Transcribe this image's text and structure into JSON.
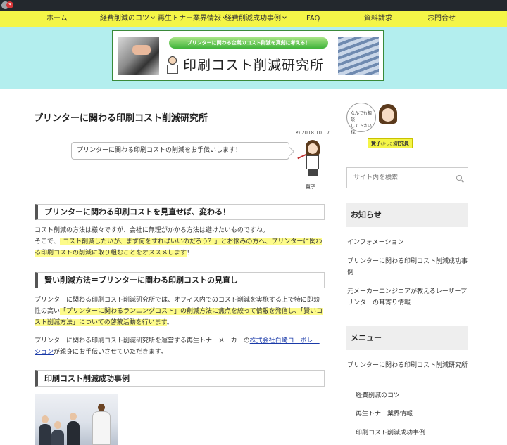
{
  "admin_bar": {
    "badge_count": "3"
  },
  "nav": {
    "items": [
      {
        "label": "ホーム",
        "has_dropdown": false
      },
      {
        "label": "経費削減のコツ",
        "has_dropdown": true
      },
      {
        "label": "再生トナー業界情報",
        "has_dropdown": true
      },
      {
        "label": "経費削減成功事例",
        "has_dropdown": true
      },
      {
        "label": "FAQ",
        "has_dropdown": false
      },
      {
        "label": "資料請求",
        "has_dropdown": false
      },
      {
        "label": "お問合せ",
        "has_dropdown": false
      }
    ]
  },
  "banner": {
    "slogan": "プリンターに関わる企業のコスト削減を真剣に考える！",
    "site_title": "印刷コスト削減研究所"
  },
  "article": {
    "title": "プリンターに関わる印刷コスト削減研究所",
    "date": "2018.10.17",
    "speech": "プリンターに関わる印刷コストの削減をお手伝いします！",
    "speaker": "賢子",
    "sections": [
      {
        "heading": "プリンターに関わる印刷コストを見直せば、変わる！",
        "p1_line1": "コスト削減の方法は様々ですが、会社に無理がかかる方法は避けたいものですね。",
        "p1_line2_pre": "そこで、",
        "p1_line2_hl": "「コスト削減したいが、まず何をすればいいのだろう？」とお悩みの方へ、プリンターに関わる印刷コストの削減に取り組むことをオススメします",
        "p1_line2_post": "！"
      },
      {
        "heading": "賢い削減方法＝プリンターに関わる印刷コストの見直し",
        "p1_pre": "プリンターに関わる印刷コスト削減研究所では、オフィス内でのコスト削減を実施する上で特に即効性の高い",
        "p1_hl": "「プリンターに関わるランニングコスト」の削減方法に焦点を絞って情報を発信し、「賢いコスト削減方法」についての啓蒙活動を行います",
        "p1_post": "。",
        "p2_pre": "プリンターに関わる印刷コスト削減研究所を運営する再生トナーメーカーの",
        "p2_link": "株式会社白崎コーポレーション",
        "p2_post": "が親身にお手伝いさせていただきます。"
      },
      {
        "heading": "印刷コスト削減成功事例"
      }
    ]
  },
  "sidebar": {
    "mascot_bubble_line1": "なんでも相談",
    "mascot_bubble_line2": "して下さいね♪",
    "mascot_label_pre": "賢子",
    "mascot_label_ruby": "(かしこ)",
    "mascot_label_post": "研究員",
    "search_placeholder": "サイト内を検索",
    "news_title": "お知らせ",
    "news_items": [
      "インフォメーション",
      "プリンターに関わる印刷コスト削減成功事例",
      "元メーカーエンジニアが教えるレーザープリンターの耳寄り情報"
    ],
    "menu_title": "メニュー",
    "menu_items": [
      "プリンターに関わる印刷コスト削減研究所",
      "経費削減のコツ",
      "再生トナー業界情報",
      "印刷コスト削減成功事例"
    ]
  },
  "colors": {
    "nav_bg": "#f4f547",
    "header_bg": "#b3eeee",
    "highlight": "#fdfb8a",
    "link": "#1a3aa8"
  }
}
